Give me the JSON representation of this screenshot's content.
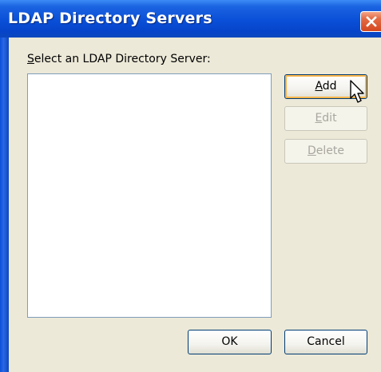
{
  "window": {
    "title": "LDAP Directory Servers"
  },
  "content": {
    "list_label_key": "S",
    "list_label_rest": "elect an LDAP Directory Server:",
    "server_list": []
  },
  "buttons": {
    "add": {
      "key": "A",
      "rest": "dd",
      "state": "hover"
    },
    "edit": {
      "key": "E",
      "rest": "dit",
      "state": "disabled"
    },
    "delete": {
      "key": "D",
      "rest": "elete",
      "state": "disabled"
    },
    "ok": "OK",
    "cancel": "Cancel"
  },
  "colors": {
    "titlebar": "#0A4FD8",
    "dialog_bg": "#ECE9D8",
    "close_button": "#D4461F",
    "button_border": "#003C74",
    "hover_highlight": "#F9B54A"
  },
  "icons": {
    "close": "close-icon",
    "cursor": "mouse-pointer-icon"
  }
}
